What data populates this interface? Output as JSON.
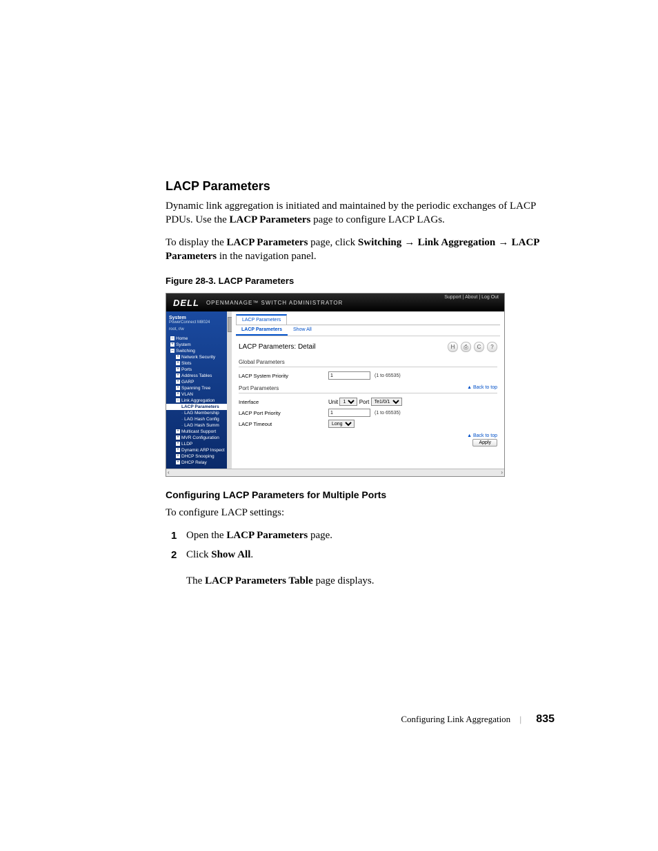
{
  "heading": "LACP Parameters",
  "para1_a": "Dynamic link aggregation is initiated and maintained by the periodic exchanges of LACP PDUs. Use the ",
  "para1_b": "LACP Parameters",
  "para1_c": " page to configure LACP LAGs.",
  "para2_a": "To display the ",
  "para2_b": "LACP Parameters",
  "para2_c": " page, click ",
  "para2_d": "Switching",
  "para2_e": "Link Aggregation",
  "para2_f": "LACP Parameters",
  "para2_g": " in the navigation panel.",
  "figcap": "Figure 28-3.    LACP Parameters",
  "subheading": "Configuring LACP Parameters for Multiple Ports",
  "intro2": "To configure LACP settings:",
  "step1_a": "Open the ",
  "step1_b": "LACP Parameters",
  "step1_c": " page.",
  "step2_a": "Click ",
  "step2_b": "Show All",
  "step2_c": ".",
  "step2_cont_a": "The ",
  "step2_cont_b": "LACP Parameters Table",
  "step2_cont_c": " page displays.",
  "footer_section": "Configuring Link Aggregation",
  "footer_page": "835",
  "shot": {
    "logo": "DELL",
    "app_title": "OPENMANAGE™ SWITCH ADMINISTRATOR",
    "toplinks": "Support  |  About  |  Log Out",
    "nav_system": "System",
    "nav_device": "PowerConnect M8024",
    "nav_user": "root, r/w",
    "nav": {
      "home": "Home",
      "system": "System",
      "switching": "Switching",
      "netsec": "Network Security",
      "slots": "Slots",
      "ports": "Ports",
      "addr": "Address Tables",
      "garp": "GARP",
      "stp": "Spanning Tree",
      "vlan": "VLAN",
      "linkagg": "Link Aggregation",
      "lacp": "LACP Parameters",
      "lagmem": "LAG Membership",
      "laghash": "LAG Hash Config",
      "laghashsum": "LAG Hash Summ",
      "mcast": "Multicast Support",
      "mvr": "MVR Configuration",
      "lldp": "LLDP",
      "darp": "Dynamic ARP Inspect",
      "dhcps": "DHCP Snooping",
      "dhcpr": "DHCP Relay"
    },
    "tab_main": "LACP Parameters",
    "subtab1": "LACP Parameters",
    "subtab2": "Show All",
    "panel_title": "LACP Parameters: Detail",
    "grp1": "Global Parameters",
    "row_sys_pri": "LACP System Priority",
    "val_sys_pri": "1",
    "hint_range": "(1 to 65535)",
    "grp2": "Port Parameters",
    "back": "▲ Back to top",
    "row_iface": "Interface",
    "unit_lbl": "Unit",
    "unit_val": "1",
    "port_lbl": "Port",
    "port_val": "Te1/0/1",
    "row_port_pri": "LACP Port Priority",
    "val_port_pri": "1",
    "row_timeout": "LACP Timeout",
    "timeout_val": "Long",
    "apply": "Apply",
    "ic_save": "H",
    "ic_print": "⎙",
    "ic_refresh": "C",
    "ic_help": "?"
  }
}
